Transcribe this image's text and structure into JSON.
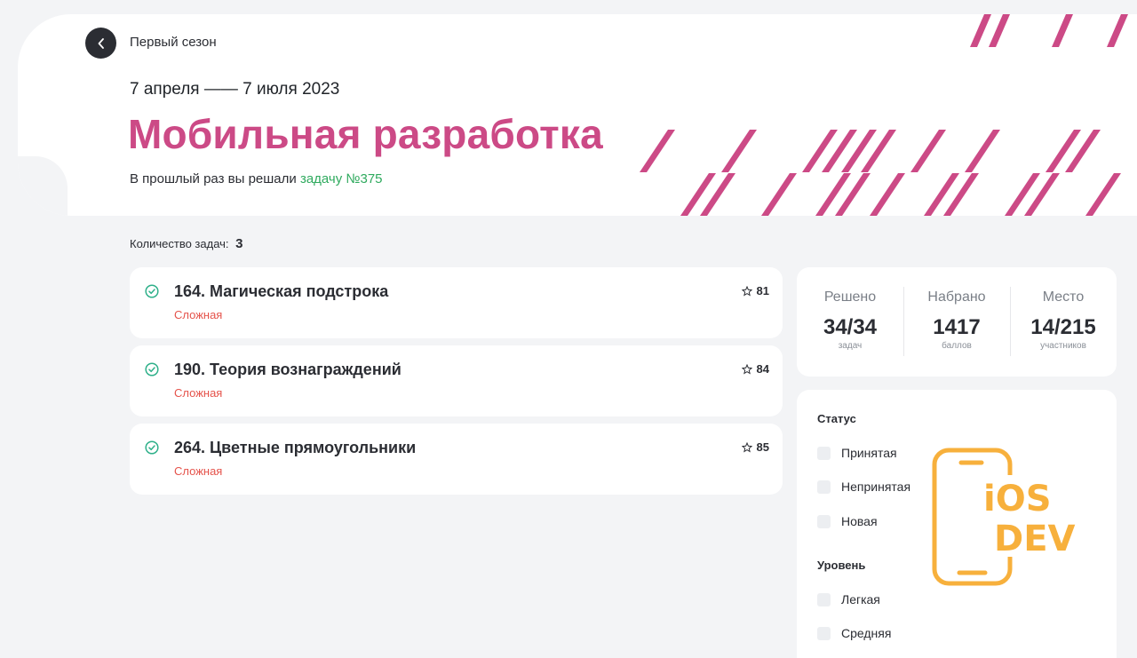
{
  "header": {
    "season": "Первый сезон",
    "dates": "7 апреля —— 7 июля 2023",
    "title": "Мобильная разработка",
    "last_task_prefix": "В прошлый раз вы решали ",
    "last_task_link": "задачу №375"
  },
  "tasks": {
    "count_label": "Количество задач:",
    "count_value": "3",
    "items": [
      {
        "title": "164. Магическая подстрока",
        "level": "Сложная",
        "rating": "81"
      },
      {
        "title": "190. Теория вознаграждений",
        "level": "Сложная",
        "rating": "84"
      },
      {
        "title": "264. Цветные прямоугольники",
        "level": "Сложная",
        "rating": "85"
      }
    ]
  },
  "stats": {
    "solved": {
      "label": "Решено",
      "value": "34/34",
      "sub": "задач"
    },
    "score": {
      "label": "Набрано",
      "value": "1417",
      "sub": "баллов"
    },
    "place": {
      "label": "Место",
      "value": "14/215",
      "sub": "участников"
    }
  },
  "filters": {
    "status_title": "Статус",
    "status_options": [
      "Принятая",
      "Непринятая",
      "Новая"
    ],
    "level_title": "Уровень",
    "level_options": [
      "Легкая",
      "Средняя"
    ]
  },
  "logo": {
    "line1": "iOS",
    "line2": "DEV"
  },
  "colors": {
    "accent_pink": "#cc4a86",
    "link_green": "#2faa5e",
    "hard_red": "#e5534b",
    "logo_orange": "#f7b03c",
    "check_green": "#2fb08a"
  },
  "icons": {
    "back": "chevron-left-icon",
    "solved": "check-circle-icon",
    "rating": "star-outline-icon"
  }
}
